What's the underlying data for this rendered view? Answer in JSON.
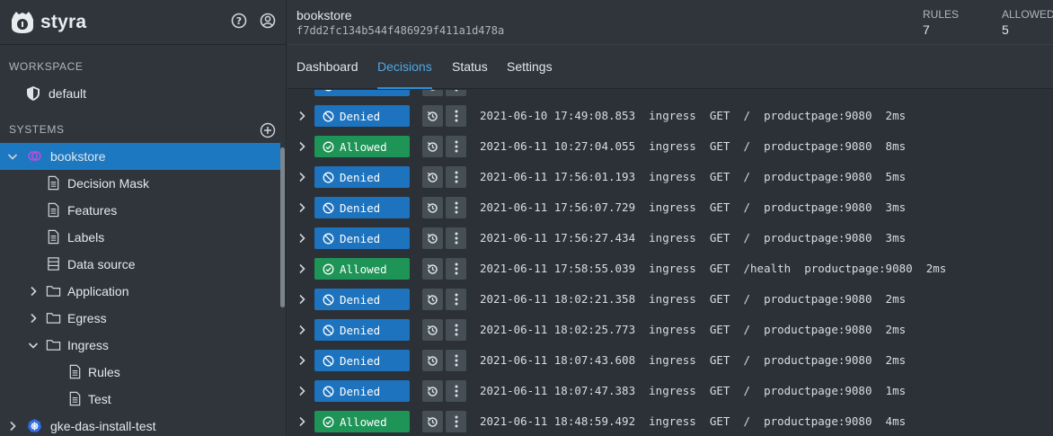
{
  "brand": {
    "name": "styra"
  },
  "workspace": {
    "title": "WORKSPACE",
    "item": "default"
  },
  "systems": {
    "title": "SYSTEMS",
    "tree": [
      {
        "label": "bookstore",
        "level": 0,
        "chevron": "down",
        "icon": "system-icon",
        "selected": true
      },
      {
        "label": "Decision Mask",
        "level": 2,
        "chevron": "",
        "icon": "file-icon"
      },
      {
        "label": "Features",
        "level": 2,
        "chevron": "",
        "icon": "file-icon"
      },
      {
        "label": "Labels",
        "level": 2,
        "chevron": "",
        "icon": "file-icon"
      },
      {
        "label": "Data source",
        "level": 2,
        "chevron": "",
        "icon": "datasource-icon"
      },
      {
        "label": "Application",
        "level": 1,
        "chevron": "right",
        "icon": "folder-icon"
      },
      {
        "label": "Egress",
        "level": 1,
        "chevron": "right",
        "icon": "folder-icon"
      },
      {
        "label": "Ingress",
        "level": 1,
        "chevron": "down",
        "icon": "folder-icon"
      },
      {
        "label": "Rules",
        "level": 3,
        "chevron": "",
        "icon": "file-icon"
      },
      {
        "label": "Test",
        "level": 3,
        "chevron": "",
        "icon": "file-icon"
      },
      {
        "label": "gke-das-install-test",
        "level": 0,
        "chevron": "right",
        "icon": "kubernetes-icon"
      }
    ]
  },
  "header": {
    "system_name": "bookstore",
    "system_id": "f7dd2fc134b544f486929f411a1d478a",
    "stats": [
      {
        "label": "RULES",
        "value": "7"
      },
      {
        "label": "ALLOWED",
        "value": "5"
      }
    ]
  },
  "tabs": [
    {
      "label": "Dashboard",
      "active": false
    },
    {
      "label": "Decisions",
      "active": true
    },
    {
      "label": "Status",
      "active": false
    },
    {
      "label": "Settings",
      "active": false
    }
  ],
  "decisions": [
    {
      "result": "Denied",
      "text": "2021-06-10 17:49:08.853  ingress  GET  /  productpage:9080  2ms"
    },
    {
      "result": "Allowed",
      "text": "2021-06-11 10:27:04.055  ingress  GET  /  productpage:9080  8ms"
    },
    {
      "result": "Denied",
      "text": "2021-06-11 17:56:01.193  ingress  GET  /  productpage:9080  5ms"
    },
    {
      "result": "Denied",
      "text": "2021-06-11 17:56:07.729  ingress  GET  /  productpage:9080  3ms"
    },
    {
      "result": "Denied",
      "text": "2021-06-11 17:56:27.434  ingress  GET  /  productpage:9080  3ms"
    },
    {
      "result": "Allowed",
      "text": "2021-06-11 17:58:55.039  ingress  GET  /health  productpage:9080  2ms"
    },
    {
      "result": "Denied",
      "text": "2021-06-11 18:02:21.358  ingress  GET  /  productpage:9080  2ms"
    },
    {
      "result": "Denied",
      "text": "2021-06-11 18:02:25.773  ingress  GET  /  productpage:9080  2ms"
    },
    {
      "result": "Denied",
      "text": "2021-06-11 18:07:43.608  ingress  GET  /  productpage:9080  2ms"
    },
    {
      "result": "Denied",
      "text": "2021-06-11 18:07:47.383  ingress  GET  /  productpage:9080  1ms"
    },
    {
      "result": "Allowed",
      "text": "2021-06-11 18:48:59.492  ingress  GET  /  productpage:9080  4ms"
    }
  ],
  "colors": {
    "accent": "#1c78c0",
    "denied": "#1e73be",
    "allowed": "#1e9457",
    "tab_active": "#4fa8e8"
  }
}
